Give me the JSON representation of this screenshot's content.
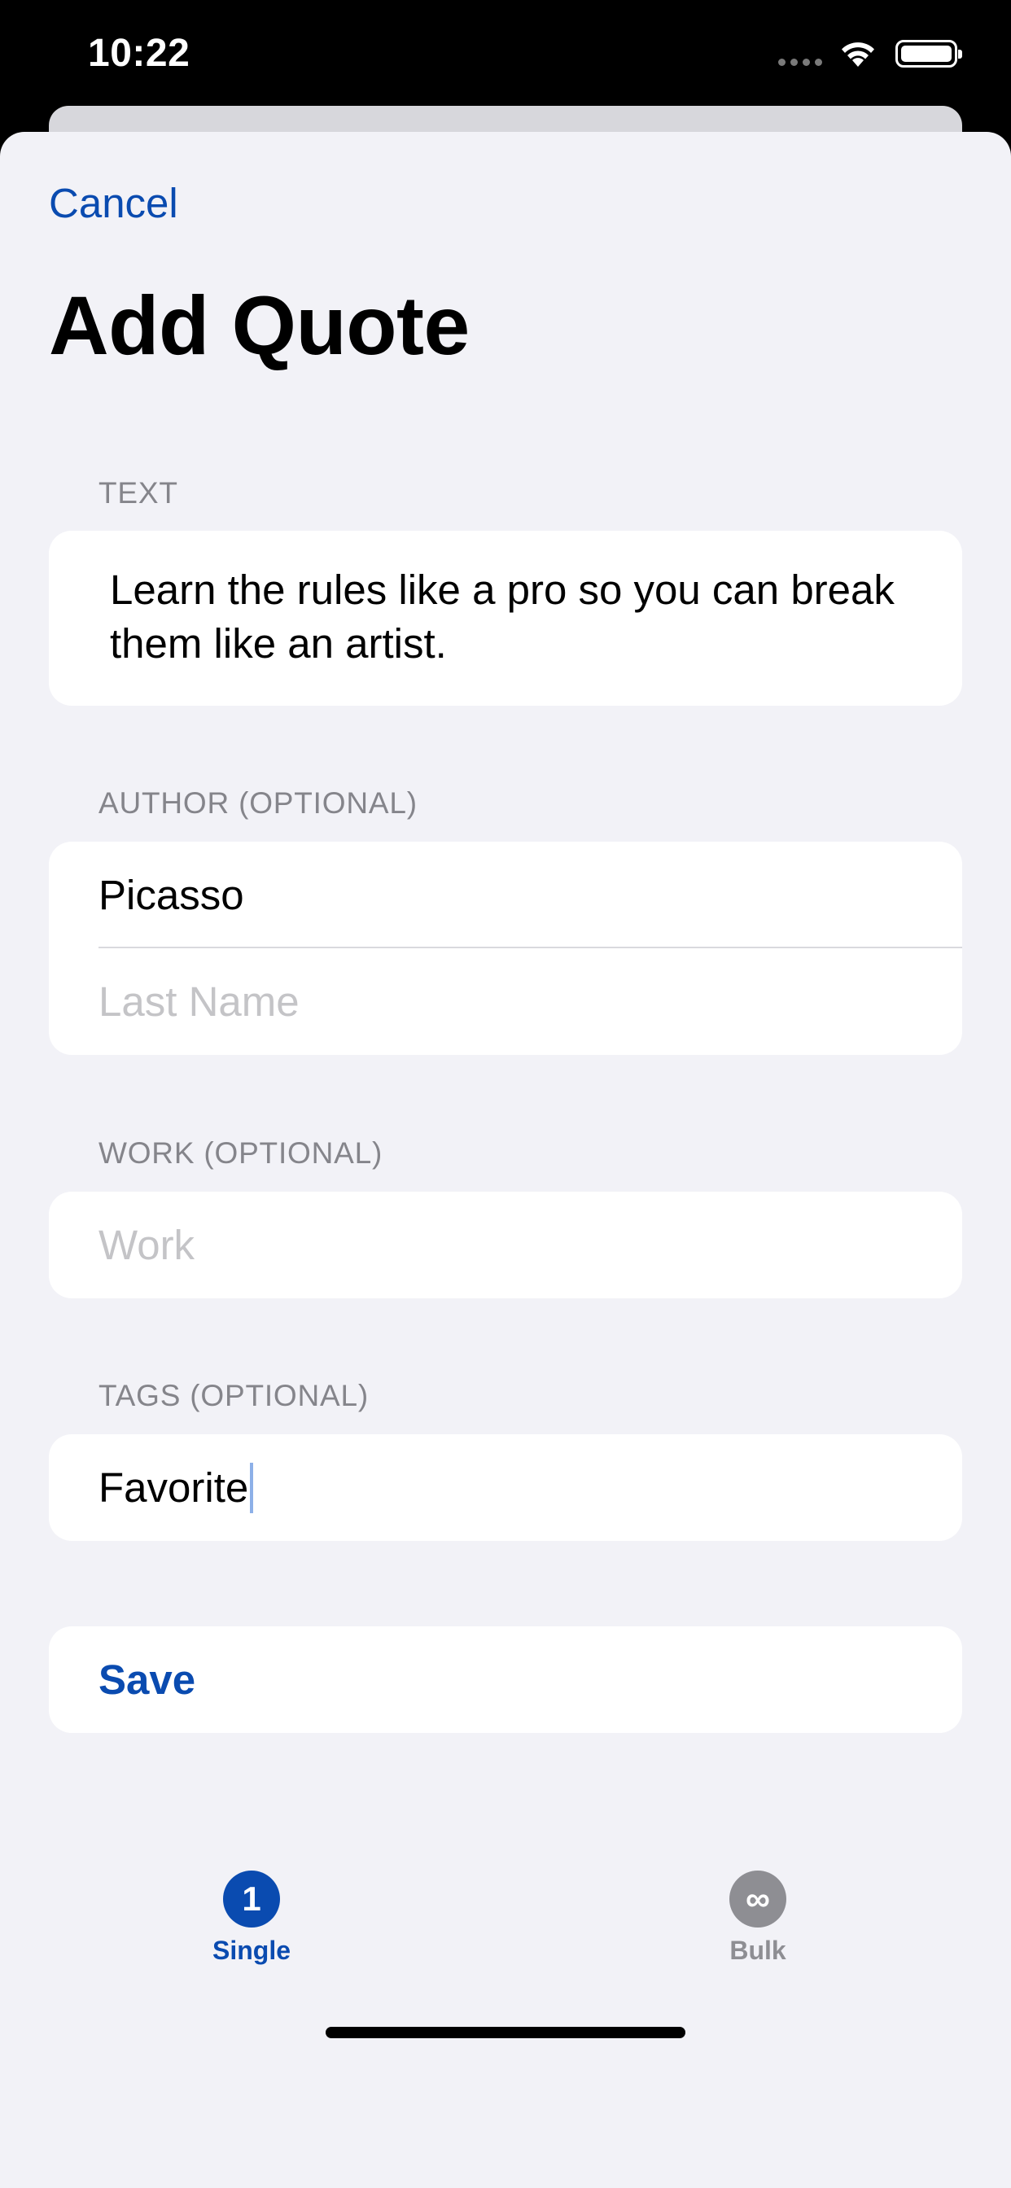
{
  "status_bar": {
    "time": "10:22"
  },
  "nav": {
    "cancel_label": "Cancel",
    "title": "Add Quote"
  },
  "form": {
    "text_section": {
      "label": "TEXT",
      "value": "Learn the rules like a pro so you can break them like an artist."
    },
    "author_section": {
      "label": "AUTHOR (OPTIONAL)",
      "first_name_value": "Picasso",
      "last_name_placeholder": "Last Name"
    },
    "work_section": {
      "label": "WORK (OPTIONAL)",
      "placeholder": "Work"
    },
    "tags_section": {
      "label": "TAGS (OPTIONAL)",
      "value": "Favorite"
    },
    "save_label": "Save"
  },
  "tabs": [
    {
      "label": "Single",
      "badge": "1",
      "selected": true
    },
    {
      "label": "Bulk",
      "badge": "∞",
      "selected": false
    }
  ],
  "colors": {
    "accent": "#0a4bb0",
    "background": "#f2f2f7",
    "placeholder": "#c4c4c7",
    "section_label": "#85858b"
  }
}
